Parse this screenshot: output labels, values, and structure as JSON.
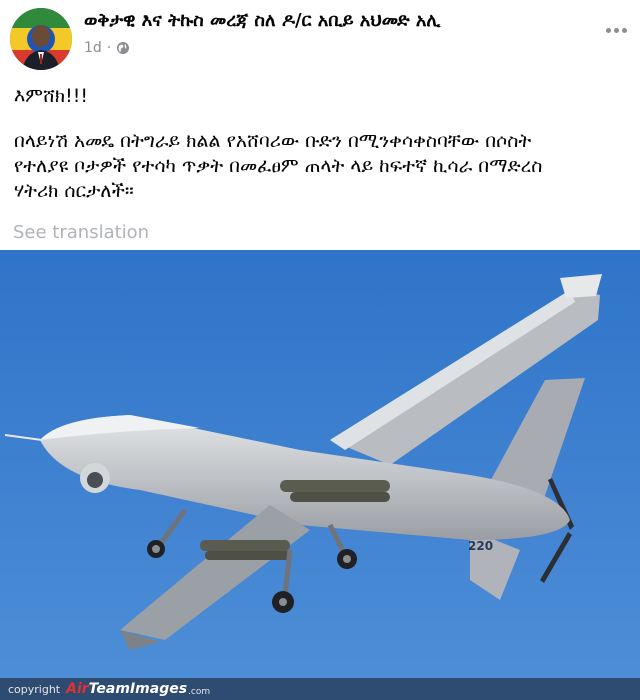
{
  "post": {
    "page_name": "ወቅታዊ እና ትኩስ መረጃ ስለ ዶ/ር አቢይ አህመድ አሊ",
    "time": "1d",
    "separator": "·",
    "exclaim": "እምሸክ!!!",
    "body_lines": [
      "በላይነሽ አመዴ በትግራይ ክልል የአሸባሪው ቡድን በሚንቀሳቀስባቸው በሶስት",
      "የተለያዩ ቦታዎች የተሳካ ጥቃት በመፈፀም ጠላት ላይ ከፍተኛ ኪሳራ በማድረስ",
      "ሃትሪክ ሰርታለች።"
    ],
    "see_translation": "See translation"
  },
  "image": {
    "tail_number": "220",
    "copyright_word": "copyright",
    "brand_a": "Air",
    "brand_rest": "TeamImages",
    "brand_tld": ".com"
  },
  "colors": {
    "sky": "#3f7fd0",
    "aircraft": "#c9ccd0",
    "text_secondary": "#8a8d91"
  },
  "icons": [
    "avatar",
    "globe-icon",
    "more-dots-icon"
  ]
}
